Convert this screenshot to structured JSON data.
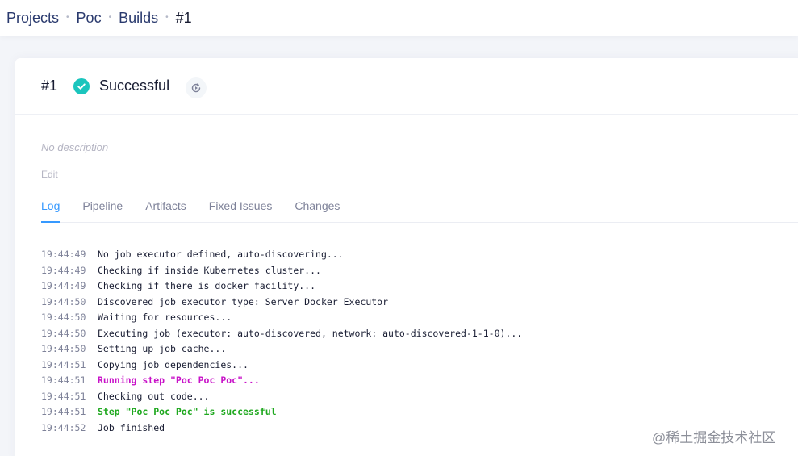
{
  "breadcrumb": {
    "items": [
      {
        "label": "Projects"
      },
      {
        "label": "Poc"
      },
      {
        "label": "Builds"
      },
      {
        "label": "#1"
      }
    ],
    "separator": "•"
  },
  "build": {
    "number": "#1",
    "status": "Successful",
    "status_color": "#1bc5bd",
    "status_icon": "check-circle-icon",
    "rerun_icon": "rerun-icon",
    "description": "No description",
    "edit_label": "Edit"
  },
  "tabs": [
    {
      "label": "Log",
      "active": true
    },
    {
      "label": "Pipeline"
    },
    {
      "label": "Artifacts"
    },
    {
      "label": "Fixed Issues"
    },
    {
      "label": "Changes"
    }
  ],
  "log": [
    {
      "time": "19:44:49",
      "message": "No job executor defined, auto-discovering...",
      "style": "normal"
    },
    {
      "time": "19:44:49",
      "message": "Checking if inside Kubernetes cluster...",
      "style": "normal"
    },
    {
      "time": "19:44:49",
      "message": "Checking if there is docker facility...",
      "style": "normal"
    },
    {
      "time": "19:44:50",
      "message": "Discovered job executor type: Server Docker Executor",
      "style": "normal"
    },
    {
      "time": "19:44:50",
      "message": "Waiting for resources...",
      "style": "normal"
    },
    {
      "time": "19:44:50",
      "message": "Executing job (executor: auto-discovered, network: auto-discovered-1-1-0)...",
      "style": "normal"
    },
    {
      "time": "19:44:50",
      "message": "Setting up job cache...",
      "style": "normal"
    },
    {
      "time": "19:44:51",
      "message": "Copying job dependencies...",
      "style": "normal"
    },
    {
      "time": "19:44:51",
      "message": "Running step \"Poc Poc Poc\"...",
      "style": "running"
    },
    {
      "time": "19:44:51",
      "message": "Checking out code...",
      "style": "normal"
    },
    {
      "time": "19:44:51",
      "message": "Step \"Poc Poc Poc\" is successful",
      "style": "success"
    },
    {
      "time": "19:44:52",
      "message": "Job finished",
      "style": "normal"
    }
  ],
  "watermark": "@稀土掘金技术社区",
  "colors": {
    "accent": "#3699ff",
    "running": "#c812c8",
    "success": "#1fa81f"
  }
}
